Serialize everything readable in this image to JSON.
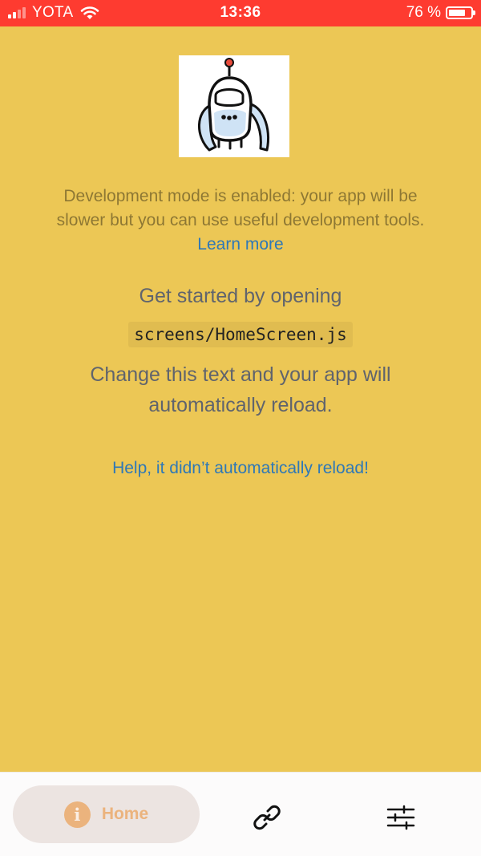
{
  "status_bar": {
    "carrier": "YOTA",
    "time": "13:36",
    "battery_percent": "76 %",
    "battery_level": 0.76,
    "signal_bars": 4,
    "signal_bars_active": 2
  },
  "main": {
    "logo_icon": "robot-mascot-icon",
    "dev_mode_text": "Development mode is enabled: your app will be slower but you can use useful development tools.",
    "learn_more_link": "Learn more",
    "get_started_text": "Get started by opening",
    "code_path": "screens/HomeScreen.js",
    "change_text": "Change this text and your app will automatically reload.",
    "help_link": "Help, it didn’t automatically reload!"
  },
  "tab_bar": {
    "tabs": [
      {
        "label": "Home",
        "icon": "info-icon",
        "active": true
      },
      {
        "label": "",
        "icon": "link-icon",
        "active": false
      },
      {
        "label": "",
        "icon": "sliders-icon",
        "active": false
      }
    ]
  },
  "colors": {
    "background": "#ecc755",
    "status_bar": "#fe3b30",
    "link": "#2e78b7",
    "active_tab_tint": "#ebb37d",
    "active_tab_bg": "#ece4e1",
    "tab_bar_bg": "#fcfbfb"
  }
}
